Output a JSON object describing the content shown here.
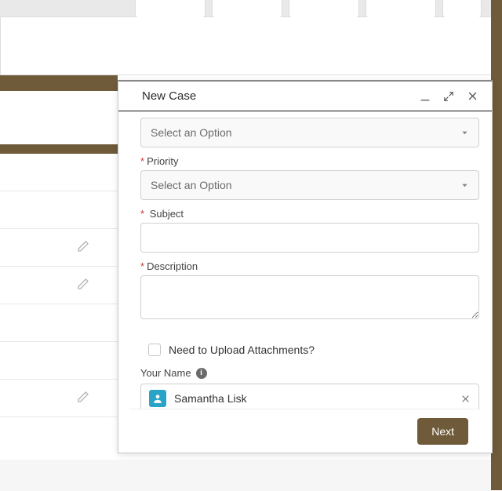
{
  "modal": {
    "title": "New Case",
    "fields": {
      "select1": {
        "placeholder": "Select an Option"
      },
      "priority": {
        "label": "Priority",
        "placeholder": "Select an Option"
      },
      "subject": {
        "label": "Subject"
      },
      "description": {
        "label": "Description"
      },
      "attachments": {
        "label": "Need to Upload Attachments?"
      },
      "your_name": {
        "label": "Your Name",
        "value": "Samantha Lisk"
      }
    },
    "footer": {
      "next": "Next"
    }
  }
}
